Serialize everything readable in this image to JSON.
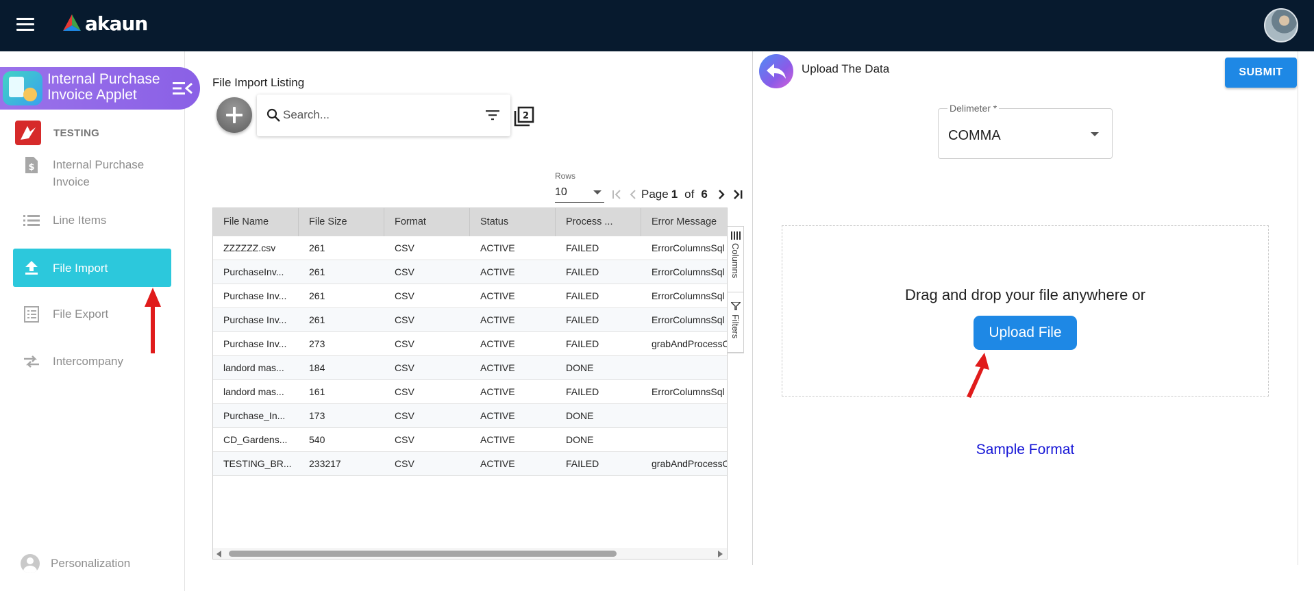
{
  "app": {
    "brand": "akaun"
  },
  "sidebar": {
    "applet_title": "Internal Purchase Invoice Applet",
    "org_name": "TESTING",
    "items": [
      {
        "label": "Internal Purchase Invoice",
        "icon": "invoice-dollar-icon"
      },
      {
        "label": "Line Items",
        "icon": "list-icon"
      },
      {
        "label": "File Import",
        "icon": "upload-icon",
        "active": true
      },
      {
        "label": "File Export",
        "icon": "document-list-icon"
      },
      {
        "label": "Intercompany",
        "icon": "transfer-arrows-icon"
      }
    ],
    "personalization": "Personalization"
  },
  "listing": {
    "title": "File Import Listing",
    "search_placeholder": "Search...",
    "rows_label": "Rows",
    "rows_value": "10",
    "page_label": "Page",
    "page_current": "1",
    "of_label": "of",
    "page_total": "6",
    "columns": [
      "File Name",
      "File Size",
      "Format",
      "Status",
      "Process ...",
      "Error Message"
    ],
    "rows": [
      [
        "ZZZZZZ.csv",
        "261",
        "CSV",
        "ACTIVE",
        "FAILED",
        "ErrorColumnsSql"
      ],
      [
        "PurchaseInv...",
        "261",
        "CSV",
        "ACTIVE",
        "FAILED",
        "ErrorColumnsSql"
      ],
      [
        "Purchase Inv...",
        "261",
        "CSV",
        "ACTIVE",
        "FAILED",
        "ErrorColumnsSql"
      ],
      [
        "Purchase Inv...",
        "261",
        "CSV",
        "ACTIVE",
        "FAILED",
        "ErrorColumnsSql"
      ],
      [
        "Purchase Inv...",
        "273",
        "CSV",
        "ACTIVE",
        "FAILED",
        "grabAndProcessC"
      ],
      [
        "landord mas...",
        "184",
        "CSV",
        "ACTIVE",
        "DONE",
        ""
      ],
      [
        "landord mas...",
        "161",
        "CSV",
        "ACTIVE",
        "FAILED",
        "ErrorColumnsSql"
      ],
      [
        "Purchase_In...",
        "173",
        "CSV",
        "ACTIVE",
        "DONE",
        ""
      ],
      [
        "CD_Gardens...",
        "540",
        "CSV",
        "ACTIVE",
        "DONE",
        ""
      ],
      [
        "TESTING_BR...",
        "233217",
        "CSV",
        "ACTIVE",
        "FAILED",
        "grabAndProcessC"
      ]
    ],
    "side_tabs": {
      "columns": "Columns",
      "filters": "Filters"
    }
  },
  "upload": {
    "title": "Upload The Data",
    "submit_label": "SUBMIT",
    "delimiter_label": "Delimeter *",
    "delimiter_value": "COMMA",
    "drop_text": "Drag and drop your file anywhere or",
    "upload_button": "Upload File",
    "sample_link": "Sample Format"
  },
  "colors": {
    "topbar": "#071a2e",
    "active_nav": "#2cc8dc",
    "applet_header": "#8a60e6",
    "primary_button": "#1e88e5",
    "link": "#1515d6",
    "annotation_arrow": "#e01b1b"
  }
}
